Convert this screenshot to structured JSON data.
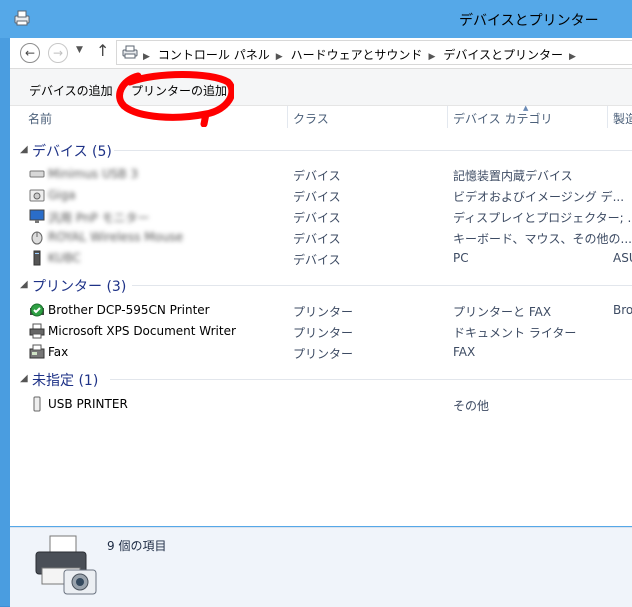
{
  "window": {
    "title": "デバイスとプリンター"
  },
  "breadcrumb": [
    "コントロール パネル",
    "ハードウェアとサウンド",
    "デバイスとプリンター"
  ],
  "toolbar": {
    "add_device": "デバイスの追加",
    "add_printer": "プリンターの追加"
  },
  "columns": {
    "name": "名前",
    "class": "クラス",
    "category": "デバイス カテゴリ",
    "maker": "製造"
  },
  "groups": [
    {
      "label": "デバイス (5)",
      "items": [
        {
          "name": "Minimus USB 3",
          "class": "デバイス",
          "category": "記憶装置内蔵デバイス",
          "maker": "",
          "icon": "usb-drive-icon",
          "blurred": true
        },
        {
          "name": "Giga",
          "class": "デバイス",
          "category": "ビデオおよびイメージング デ...",
          "maker": "",
          "icon": "camera-icon",
          "blurred": true
        },
        {
          "name": "汎用 PnP モニター",
          "class": "デバイス",
          "category": "ディスプレイとプロジェクター; ...",
          "maker": "",
          "icon": "monitor-icon",
          "blurred": true
        },
        {
          "name": "ROYAL Wireless Mouse",
          "class": "デバイス",
          "category": "キーボード、マウス、その他の...",
          "maker": "",
          "icon": "mouse-icon",
          "blurred": true
        },
        {
          "name": "KUBC",
          "class": "デバイス",
          "category": "PC",
          "maker": "ASU",
          "icon": "computer-tower-icon",
          "blurred": true
        }
      ]
    },
    {
      "label": "プリンター (3)",
      "items": [
        {
          "name": "Brother DCP-595CN Printer",
          "class": "プリンター",
          "category": "プリンターと FAX",
          "maker": "Bro",
          "icon": "default-printer-icon",
          "blurred": false
        },
        {
          "name": "Microsoft XPS Document Writer",
          "class": "プリンター",
          "category": "ドキュメント ライター",
          "maker": "",
          "icon": "printer-icon",
          "blurred": false
        },
        {
          "name": "Fax",
          "class": "プリンター",
          "category": "FAX",
          "maker": "",
          "icon": "fax-icon",
          "blurred": false
        }
      ]
    },
    {
      "label": "未指定 (1)",
      "items": [
        {
          "name": "USB PRINTER",
          "class": "",
          "category": "その他",
          "maker": "",
          "icon": "usb-device-icon",
          "blurred": false
        }
      ]
    }
  ],
  "details": {
    "count": "9 個の項目"
  },
  "colors": {
    "annotation": "#ff0000",
    "group_heading": "#1e3287",
    "titlebar": "#55a8e8"
  }
}
